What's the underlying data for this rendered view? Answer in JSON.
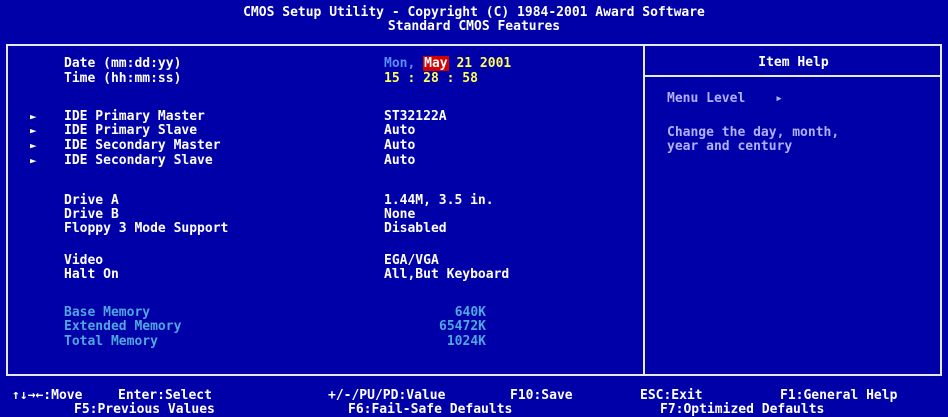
{
  "header": {
    "line1": "CMOS Setup Utility - Copyright (C) 1984-2001 Award Software",
    "line2": "Standard CMOS Features"
  },
  "fields": {
    "date": {
      "label": "Date (mm:dd:yy)",
      "day": "Mon,",
      "month": "May",
      "rest": "21 2001"
    },
    "time": {
      "label": "Time (hh:mm:ss)",
      "value": "15 : 28 : 58"
    },
    "ide_primary_master": {
      "label": "IDE Primary Master",
      "value": "ST32122A"
    },
    "ide_primary_slave": {
      "label": "IDE Primary Slave",
      "value": "Auto"
    },
    "ide_secondary_master": {
      "label": "IDE Secondary Master",
      "value": "Auto"
    },
    "ide_secondary_slave": {
      "label": "IDE Secondary Slave",
      "value": "Auto"
    },
    "drive_a": {
      "label": "Drive A",
      "value": "1.44M, 3.5 in."
    },
    "drive_b": {
      "label": "Drive B",
      "value": "None"
    },
    "floppy3": {
      "label": "Floppy 3 Mode Support",
      "value": "Disabled"
    },
    "video": {
      "label": "Video",
      "value": "EGA/VGA"
    },
    "halt_on": {
      "label": "Halt On",
      "value": "All,But Keyboard"
    },
    "base_memory": {
      "label": "Base Memory",
      "value": "640K"
    },
    "extended_memory": {
      "label": "Extended Memory",
      "value": "65472K"
    },
    "total_memory": {
      "label": "Total Memory",
      "value": "1024K"
    }
  },
  "help": {
    "title": "Item Help",
    "menu_level": "Menu Level",
    "menu_arrow": "▸",
    "line1": "Change the day, month,",
    "line2": "year and century"
  },
  "footer": {
    "move": "↑↓→←:Move",
    "enter": "Enter:Select",
    "value": "+/-/PU/PD:Value",
    "save": "F10:Save",
    "exit": "ESC:Exit",
    "help": "F1:General Help",
    "prev": "F5:Previous Values",
    "failsafe": "F6:Fail-Safe Defaults",
    "optimized": "F7:Optimized Defaults"
  }
}
